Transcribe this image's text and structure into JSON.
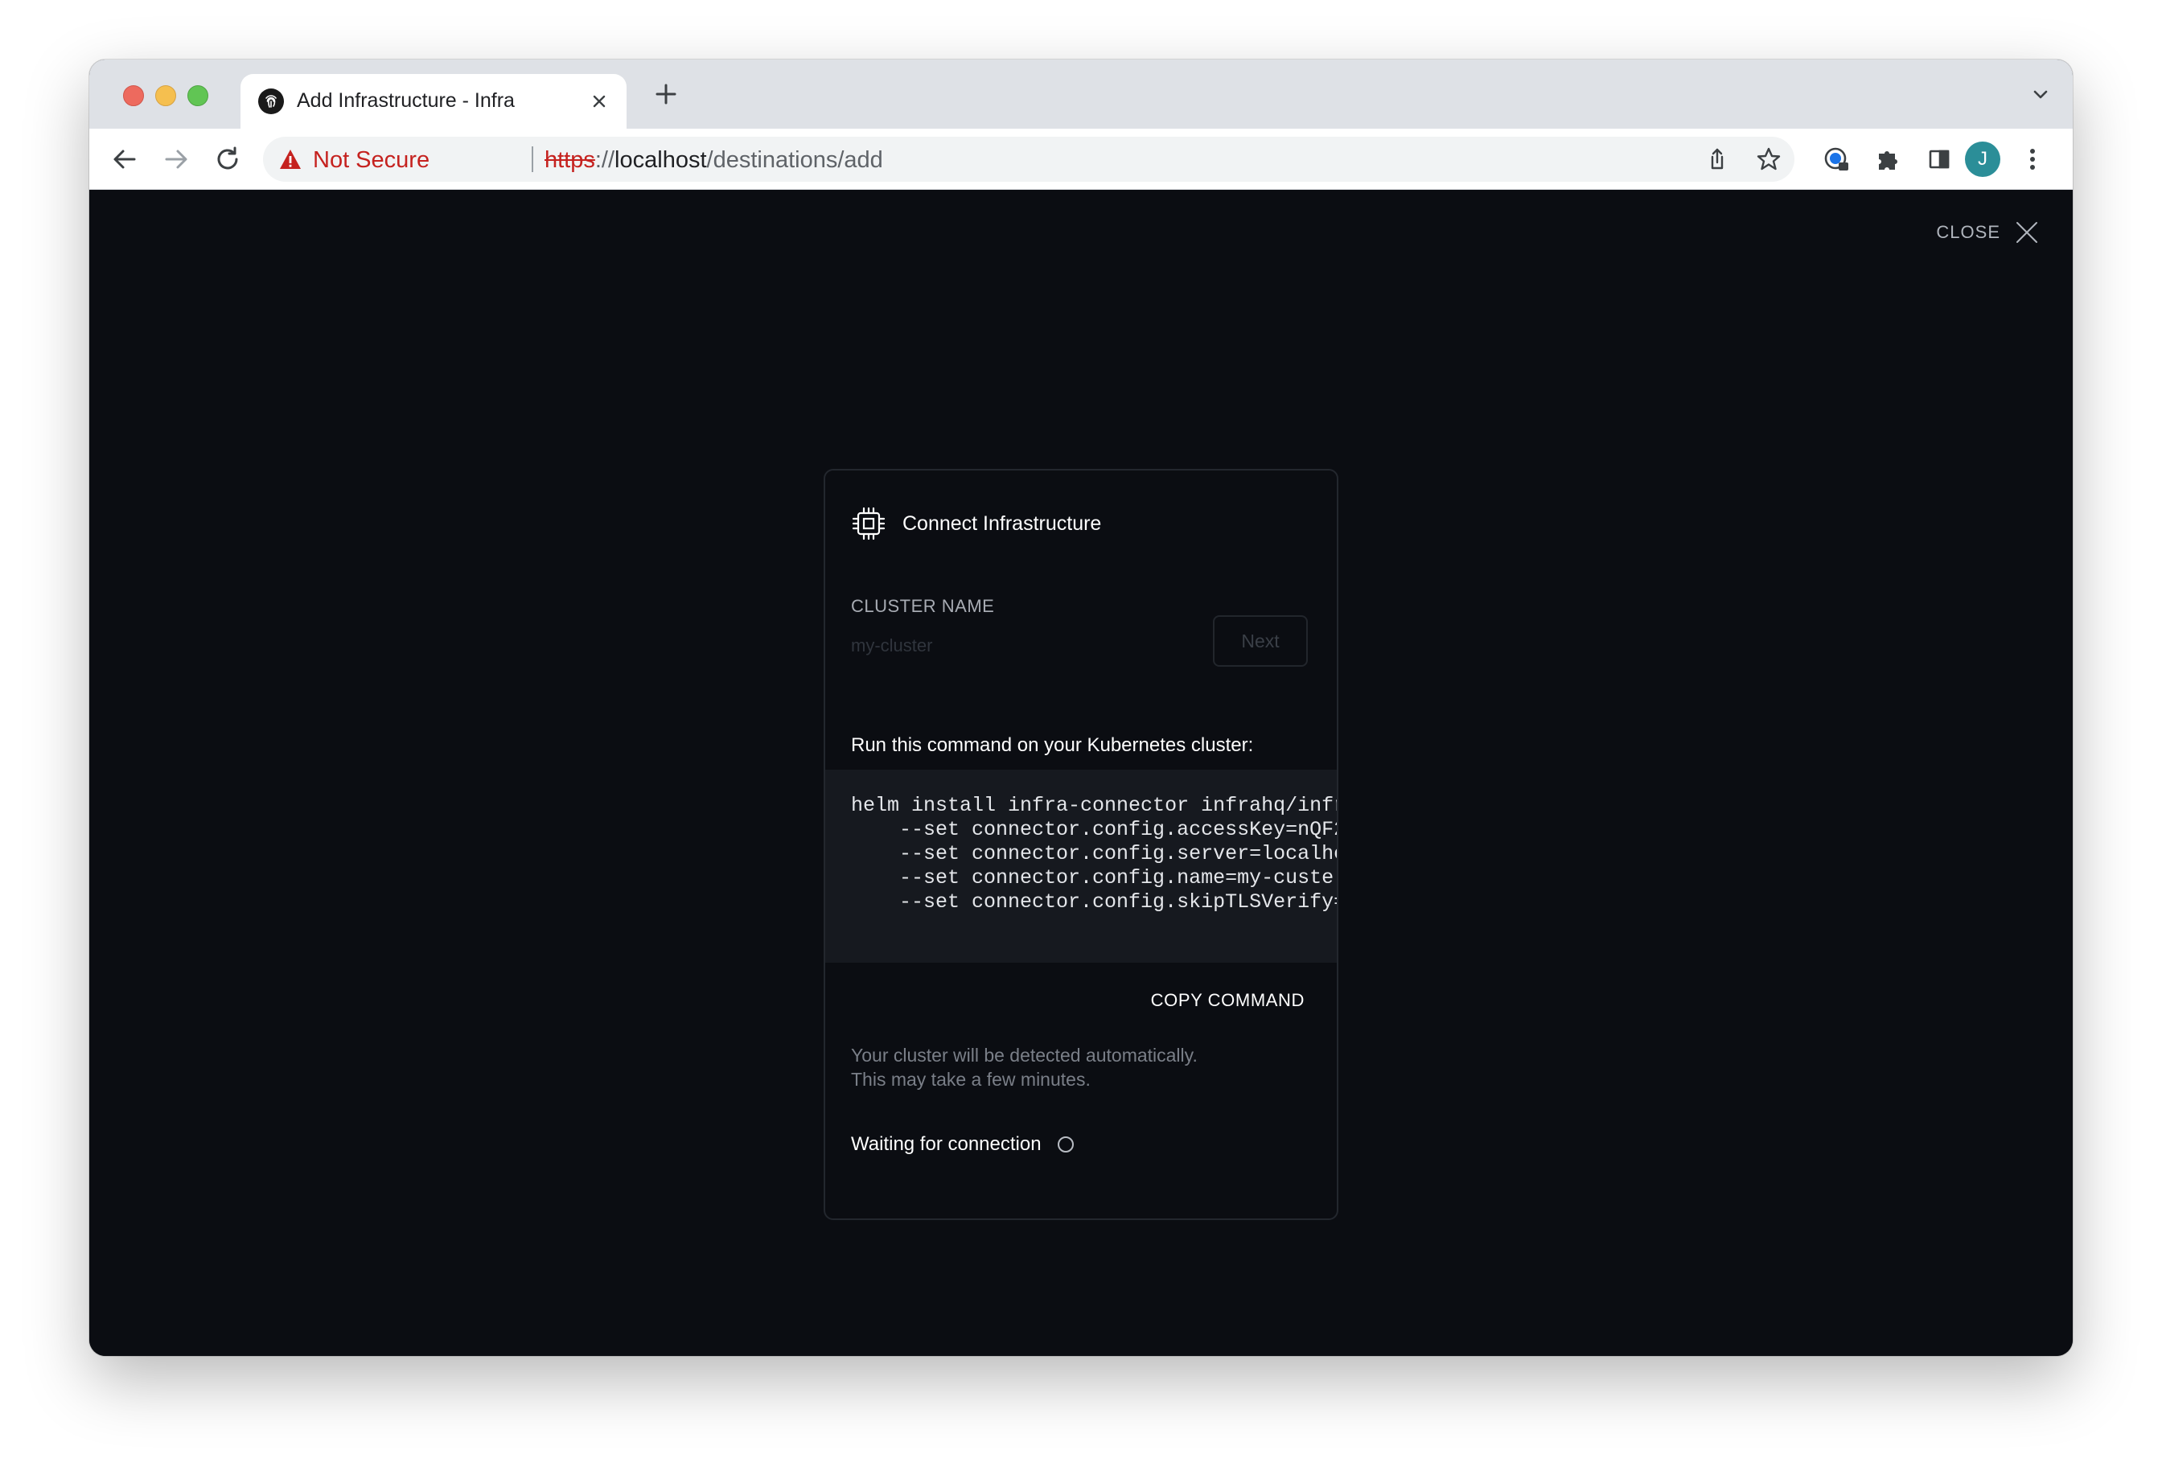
{
  "browser": {
    "tab": {
      "title": "Add Infrastructure - Infra",
      "favicon": "infra-fingerprint-icon"
    },
    "omnibox": {
      "security_label": "Not Secure",
      "url_scheme": "https",
      "url_separator": "://",
      "url_host": "localhost",
      "url_path": "/destinations/add"
    },
    "profile_initial": "J"
  },
  "page": {
    "close_label": "CLOSE",
    "card": {
      "title": "Connect Infrastructure",
      "title_icon": "cpu-chip-icon",
      "cluster_name_label": "CLUSTER NAME",
      "cluster_name_placeholder": "my-cluster",
      "next_label": "Next",
      "run_instruction": "Run this command on your Kubernetes cluster:",
      "command_lines": [
        "helm install infra-connector infrahq/infr",
        "    --set connector.config.accessKey=nQF2",
        "    --set connector.config.server=localhc",
        "    --set connector.config.name=my-custe",
        "    --set connector.config.skipTLSVerify="
      ],
      "copy_label": "COPY COMMAND",
      "detect_line1": "Your cluster will be detected automatically.",
      "detect_line2": "This may take a few minutes.",
      "waiting_label": "Waiting for connection"
    }
  },
  "colors": {
    "page_bg": "#0b0d12",
    "code_bg": "#16191f",
    "insecure_red": "#c5221f"
  }
}
